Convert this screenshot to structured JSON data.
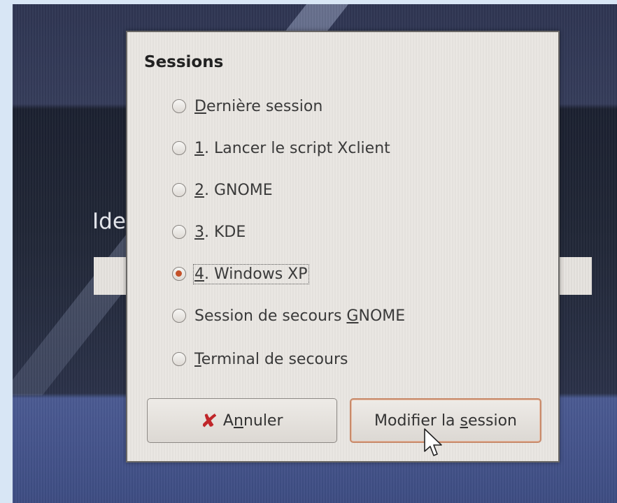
{
  "background": {
    "login_label": "Ide"
  },
  "dialog": {
    "title": "Sessions",
    "options": [
      {
        "pre": "",
        "key": "D",
        "post": "ernière session",
        "checked": false
      },
      {
        "pre": "",
        "key": "1",
        "post": ". Lancer le script Xclient",
        "checked": false
      },
      {
        "pre": "",
        "key": "2",
        "post": ". GNOME",
        "checked": false
      },
      {
        "pre": "",
        "key": "3",
        "post": ". KDE",
        "checked": false
      },
      {
        "pre": "",
        "key": "4",
        "post": ". Windows XP",
        "checked": true
      },
      {
        "pre": "Session de secours ",
        "key": "G",
        "post": "NOME",
        "checked": false
      },
      {
        "pre": "",
        "key": "T",
        "post": "erminal de secours",
        "checked": false
      }
    ],
    "cancel_button": {
      "pre": "A",
      "key": "n",
      "post": "nuler",
      "icon": "red-x-icon"
    },
    "modify_button": {
      "pre": "Modifier la ",
      "key": "s",
      "post": "ession"
    }
  },
  "colors": {
    "radio_selected": "#c4522a",
    "cancel_icon": "#c0262a",
    "default_button_border": "#c88a6a"
  }
}
